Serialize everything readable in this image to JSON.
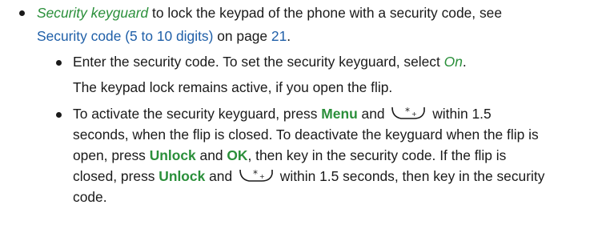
{
  "item1": {
    "term": "Security keyguard",
    "text1": " to lock the keypad of the phone with a security code, see",
    "link": "Security code (5 to 10 digits)",
    "text2": " on page ",
    "page_ref": "21",
    "text3": "."
  },
  "sub1": {
    "text1": "Enter the security code. To set the security keyguard, select ",
    "on": "On",
    "text2": ".",
    "note": "The keypad lock remains active, if you open the flip."
  },
  "sub2": {
    "l1_a": "To activate the security keyguard, press ",
    "menu": "Menu",
    "l1_b": " and ",
    "l1_c": " within 1.5",
    "l2": "seconds, when the flip is closed. To deactivate the keyguard when the flip is",
    "l3_a": "open, press ",
    "unlock1": "Unlock",
    "l3_b": " and ",
    "ok": "OK",
    "l3_c": ", then key in the security code. If the flip is",
    "l4_a": "closed, press ",
    "unlock2": "Unlock",
    "l4_b": " and ",
    "l4_c": " within 1.5 seconds, then key in the security",
    "l5": "code."
  },
  "icons": {
    "star_key": "star-plus-key-icon"
  },
  "colors": {
    "accent_green": "#2a8f3a",
    "link_blue": "#1f5fa8",
    "text": "#1a1a1a"
  }
}
